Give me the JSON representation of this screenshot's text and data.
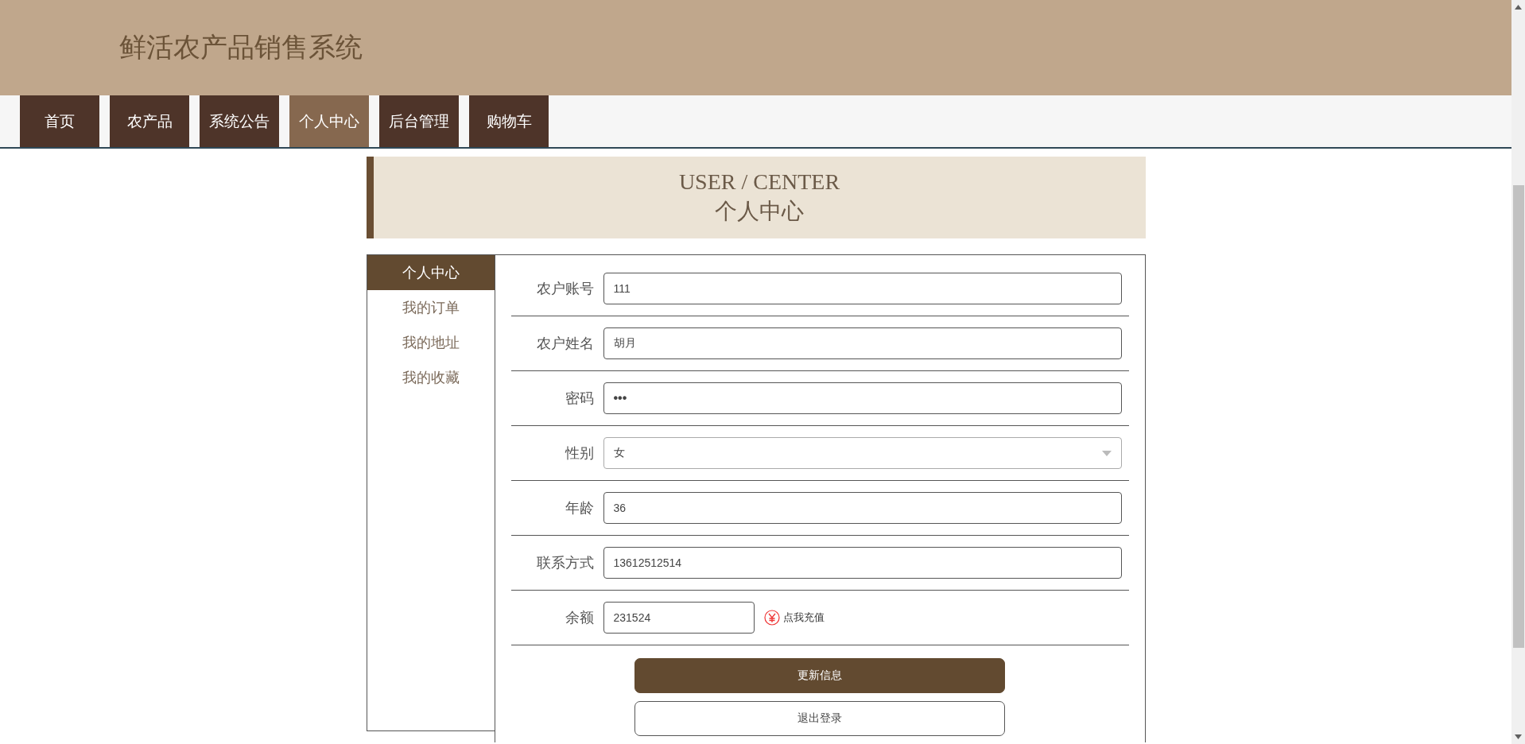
{
  "site_title": "鲜活农产品销售系统",
  "nav": [
    {
      "label": "首页",
      "selected": false
    },
    {
      "label": "农产品",
      "selected": false
    },
    {
      "label": "系统公告",
      "selected": false
    },
    {
      "label": "个人中心",
      "selected": true
    },
    {
      "label": "后台管理",
      "selected": false
    },
    {
      "label": "购物车",
      "selected": false
    }
  ],
  "banner": {
    "title_en": "USER / CENTER",
    "title_zh": "个人中心"
  },
  "sidebar": {
    "items": [
      {
        "label": "个人中心",
        "selected": true
      },
      {
        "label": "我的订单",
        "selected": false
      },
      {
        "label": "我的地址",
        "selected": false
      },
      {
        "label": "我的收藏",
        "selected": false
      }
    ]
  },
  "form": {
    "fields": [
      {
        "label": "农户账号",
        "kind": "text",
        "value": "111"
      },
      {
        "label": "农户姓名",
        "kind": "text",
        "value": "胡月"
      },
      {
        "label": "密码",
        "kind": "password",
        "value": "•••"
      },
      {
        "label": "性别",
        "kind": "select",
        "value": "女"
      },
      {
        "label": "年龄",
        "kind": "text",
        "value": "36"
      },
      {
        "label": "联系方式",
        "kind": "text",
        "value": "13612512514"
      },
      {
        "label": "余额",
        "kind": "balance",
        "value": "231524",
        "link": "点我充值"
      }
    ],
    "buttons": [
      {
        "label": "更新信息",
        "kind": "primary"
      },
      {
        "label": "退出登录",
        "kind": "secondary"
      }
    ]
  }
}
